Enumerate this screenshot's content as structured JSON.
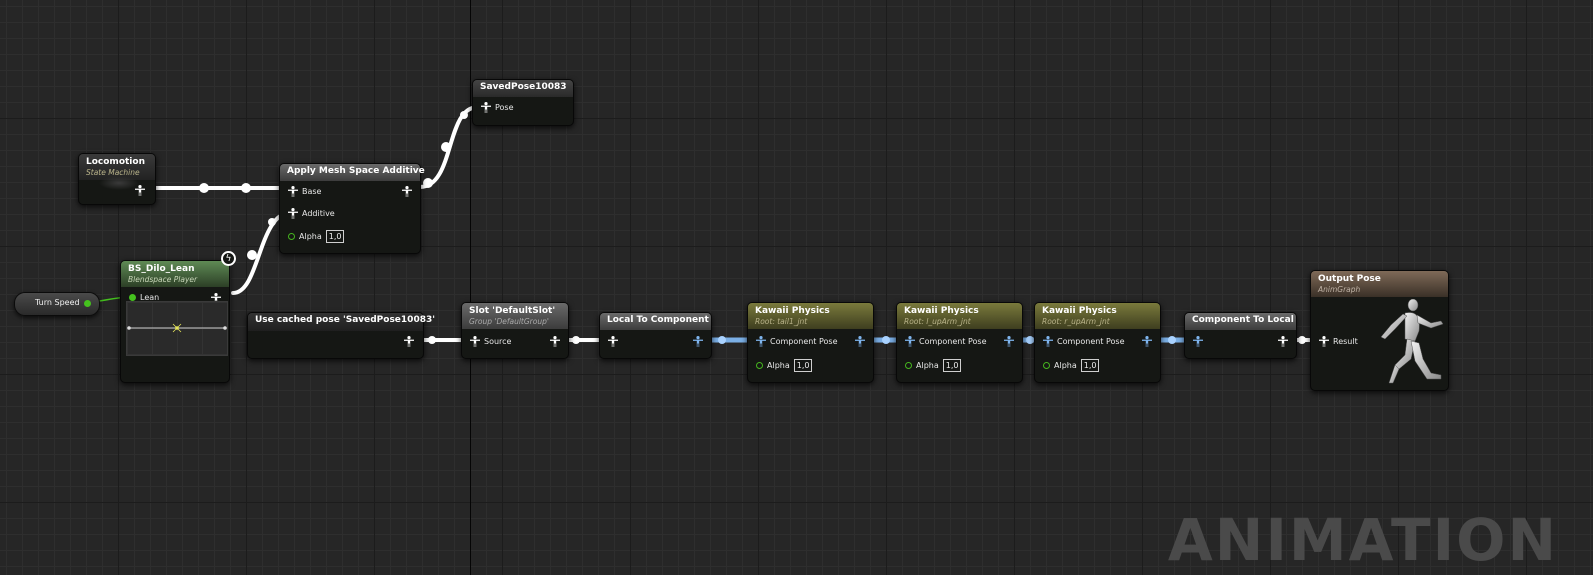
{
  "watermark": "ANIMATION",
  "colors": {
    "background": "#262626",
    "exec_wire": "#ffffff",
    "component_wire": "#7fb6f0",
    "float_wire": "#45c21e"
  },
  "icons": {
    "pose_pin": "pose-figure-icon",
    "alpha_pin": "float-pin-icon",
    "dynamic": "lightning-icon",
    "output": "mannequin-icon"
  },
  "nodes": {
    "turn_speed": {
      "label": "Turn Speed"
    },
    "locomotion": {
      "title": "Locomotion",
      "subtitle": "State Machine"
    },
    "apply_mesh": {
      "title": "Apply Mesh Space Additive",
      "pins": {
        "base": "Base",
        "additive": "Additive",
        "alpha": "Alpha",
        "alpha_value": "1,0"
      }
    },
    "saved_pose": {
      "title": "SavedPose10083",
      "pin": "Pose"
    },
    "bs_dilo": {
      "title": "BS_Dilo_Lean",
      "subtitle": "Blendspace Player",
      "pin": "Lean"
    },
    "cached_pose": {
      "title": "Use cached pose 'SavedPose10083'"
    },
    "slot": {
      "title": "Slot 'DefaultSlot'",
      "subtitle": "Group 'DefaultGroup'",
      "pin": "Source"
    },
    "local_to_component": {
      "title": "Local To Component"
    },
    "kawaii_1": {
      "title": "Kawaii Physics",
      "subtitle": "Root: tail1_jnt",
      "pose": "Component Pose",
      "alpha": "Alpha",
      "alpha_value": "1,0"
    },
    "kawaii_2": {
      "title": "Kawaii Physics",
      "subtitle": "Root: l_upArm_jnt",
      "pose": "Component Pose",
      "alpha": "Alpha",
      "alpha_value": "1,0"
    },
    "kawaii_3": {
      "title": "Kawaii Physics",
      "subtitle": "Root: r_upArm_jnt",
      "pose": "Component Pose",
      "alpha": "Alpha",
      "alpha_value": "1,0"
    },
    "component_to_local": {
      "title": "Component To Local"
    },
    "output_pose": {
      "title": "Output Pose",
      "subtitle": "AnimGraph",
      "pin": "Result"
    }
  }
}
